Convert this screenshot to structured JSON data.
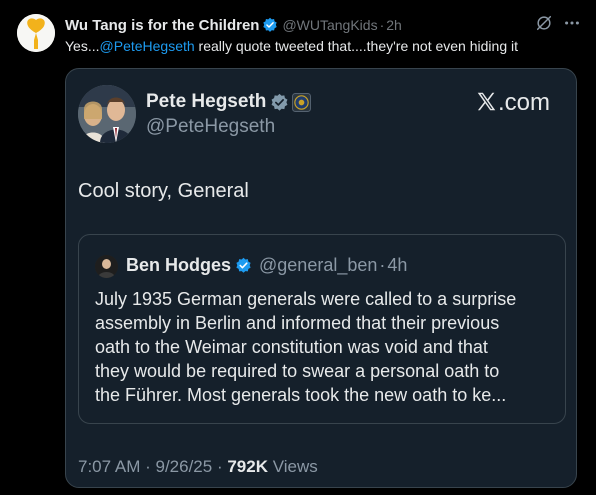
{
  "post": {
    "author_name": "Wu Tang is for the Children",
    "author_handle": "@WUTangKids",
    "separator": "·",
    "time": "2h",
    "text_prefix": "Yes...",
    "mention": "@PeteHegseth",
    "text_suffix": " really quote tweeted that....they're not even hiding it"
  },
  "card": {
    "author_name": "Pete Hegseth",
    "author_handle": "@PeteHegseth",
    "site": ".com",
    "text": "Cool story, General",
    "quote": {
      "author_name": "Ben Hodges",
      "author_handle": "@general_ben",
      "separator": "·",
      "time": "4h",
      "lines": [
        "July 1935 German generals were called to a surprise",
        "assembly in Berlin and informed that their previous",
        "oath to the Weimar constitution was void and that",
        "they would be required to swear a personal oath to",
        "the Führer. Most generals took the new oath to ke..."
      ]
    },
    "meta": {
      "time": "7:07 AM",
      "separator": " · ",
      "date": "9/26/25",
      "separator2": " · ",
      "views_count": "792K",
      "views_label": " Views"
    }
  },
  "colors": {
    "background": "#000000",
    "card_background": "#15202b",
    "link": "#1d9bf0",
    "verified": "#1d9bf0",
    "muted": "#71767b"
  },
  "icons": [
    "heart-balloon-avatar-icon",
    "verified-badge-icon",
    "grok-icon",
    "more-icon",
    "government-seal-icon",
    "x-logo-icon"
  ]
}
